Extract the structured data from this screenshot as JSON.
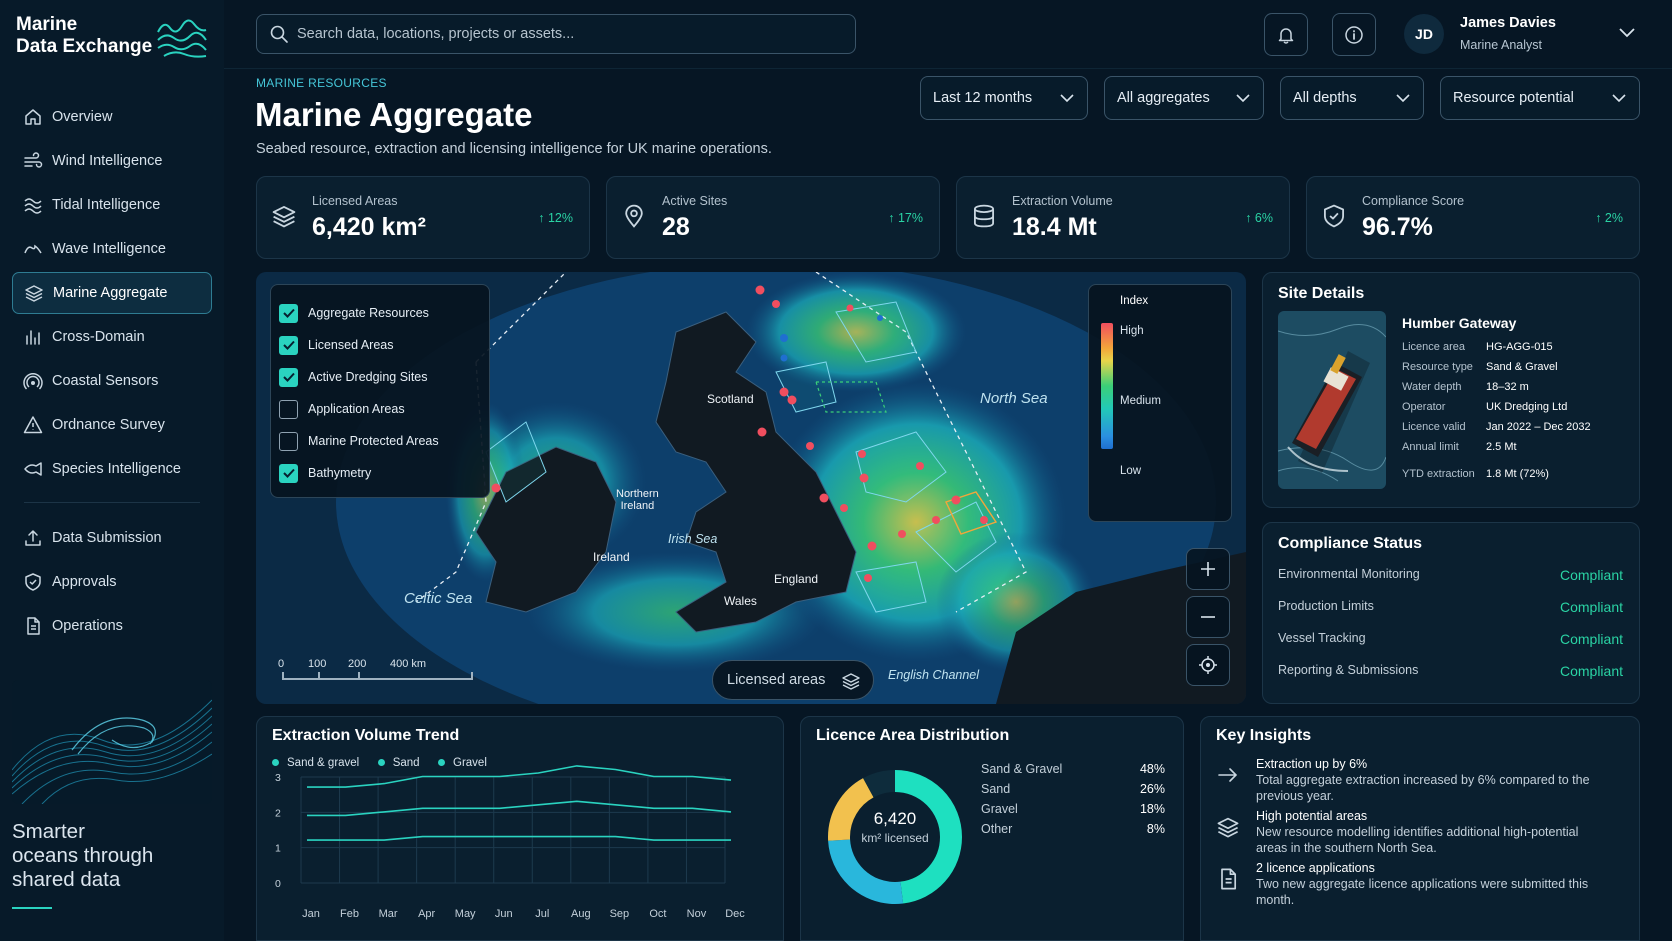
{
  "app": {
    "title_line1": "Marine",
    "title_line2": "Data Exchange",
    "tagline_line1": "Smarter",
    "tagline_line2": "oceans through",
    "tagline_line3": "shared data"
  },
  "sidebar": {
    "primary": [
      {
        "label": "Overview",
        "icon": "home-icon"
      },
      {
        "label": "Wind Intelligence",
        "icon": "wind-icon"
      },
      {
        "label": "Tidal Intelligence",
        "icon": "tide-icon"
      },
      {
        "label": "Wave Intelligence",
        "icon": "wave-icon"
      },
      {
        "label": "Marine Aggregate",
        "icon": "layers-icon",
        "active": true
      },
      {
        "label": "Cross-Domain",
        "icon": "bar-chart-icon"
      },
      {
        "label": "Coastal Sensors",
        "icon": "sensor-icon"
      },
      {
        "label": "Ordnance Survey",
        "icon": "warning-icon"
      },
      {
        "label": "Species Intelligence",
        "icon": "fish-icon"
      }
    ],
    "secondary": [
      {
        "label": "Data Submission",
        "icon": "upload-icon"
      },
      {
        "label": "Approvals",
        "icon": "shield-check-icon"
      },
      {
        "label": "Operations",
        "icon": "document-icon"
      }
    ]
  },
  "header": {
    "search_placeholder": "Search data, locations, projects or assets...",
    "user_initials": "JD",
    "user_name": "James Davies",
    "user_role": "Marine Analyst"
  },
  "page": {
    "eyebrow": "MARINE RESOURCES",
    "title": "Marine Aggregate",
    "subtitle": "Seabed resource, extraction and licensing intelligence for UK marine operations."
  },
  "filters": [
    {
      "label": "Last 12 months"
    },
    {
      "label": "All aggregates"
    },
    {
      "label": "All depths"
    },
    {
      "label": "Resource potential"
    }
  ],
  "kpis": [
    {
      "label": "Licensed Areas",
      "value": "6,420 km²",
      "delta": "12%",
      "icon": "layers-icon"
    },
    {
      "label": "Active Sites",
      "value": "28",
      "delta": "17%",
      "icon": "location-pin-icon"
    },
    {
      "label": "Extraction Volume",
      "value": "18.4 Mt",
      "delta": "6%",
      "icon": "database-icon"
    },
    {
      "label": "Compliance Score",
      "value": "96.7%",
      "delta": "2%",
      "icon": "shield-check-icon"
    }
  ],
  "map": {
    "layers": [
      {
        "label": "Aggregate Resources",
        "checked": true
      },
      {
        "label": "Licensed Areas",
        "checked": true
      },
      {
        "label": "Active Dredging Sites",
        "checked": true
      },
      {
        "label": "Application Areas",
        "checked": false
      },
      {
        "label": "Marine Protected Areas",
        "checked": false
      },
      {
        "label": "Bathymetry",
        "checked": true
      }
    ],
    "legend": {
      "title": "Index",
      "high": "High",
      "medium": "Medium",
      "low": "Low"
    },
    "labels": {
      "scotland": "Scotland",
      "northern_ireland_1": "Northern",
      "northern_ireland_2": "Ireland",
      "ireland": "Ireland",
      "england": "England",
      "wales": "Wales",
      "north_sea": "North Sea",
      "irish_sea": "Irish Sea",
      "celtic_sea": "Celtic Sea",
      "english_channel": "English Channel"
    },
    "scale": [
      "0",
      "100",
      "200",
      "400 km"
    ],
    "layer_pill": "Licensed areas"
  },
  "site_details": {
    "title": "Site Details",
    "name": "Humber Gateway",
    "rows": [
      {
        "k": "Licence area",
        "v": "HG-AGG-015"
      },
      {
        "k": "Resource type",
        "v": "Sand & Gravel"
      },
      {
        "k": "Water depth",
        "v": "18–32 m"
      },
      {
        "k": "Operator",
        "v": "UK Dredging Ltd"
      },
      {
        "k": "Licence valid",
        "v": "Jan 2022 – Dec 2032"
      },
      {
        "k": "Annual limit",
        "v": "2.5 Mt"
      },
      {
        "k": "YTD extraction",
        "v": "1.8 Mt (72%)"
      }
    ]
  },
  "compliance": {
    "title": "Compliance Status",
    "rows": [
      {
        "label": "Environmental Monitoring",
        "status": "Compliant"
      },
      {
        "label": "Production Limits",
        "status": "Compliant"
      },
      {
        "label": "Vessel Tracking",
        "status": "Compliant"
      },
      {
        "label": "Reporting & Submissions",
        "status": "Compliant"
      }
    ]
  },
  "trend": {
    "title": "Extraction Volume Trend",
    "chart_data": {
      "type": "line",
      "title": "Extraction Volume Trend",
      "categories": [
        "Jan",
        "Feb",
        "Mar",
        "Apr",
        "May",
        "Jun",
        "Jul",
        "Aug",
        "Sep",
        "Oct",
        "Nov",
        "Dec"
      ],
      "ylim": [
        0,
        3
      ],
      "yticks": [
        "3",
        "2",
        "1",
        "0"
      ],
      "grid": true,
      "legend": "top-left",
      "series": [
        {
          "name": "Sand & gravel",
          "values": [
            2.6,
            2.6,
            2.7,
            2.9,
            2.9,
            2.9,
            3.0,
            3.2,
            3.1,
            2.9,
            2.9,
            2.8
          ]
        },
        {
          "name": "Sand",
          "values": [
            1.8,
            1.8,
            1.9,
            2.0,
            2.0,
            2.0,
            2.1,
            2.2,
            2.1,
            2.0,
            2.0,
            1.9
          ]
        },
        {
          "name": "Gravel",
          "values": [
            1.1,
            1.1,
            1.1,
            1.2,
            1.2,
            1.2,
            1.2,
            1.2,
            1.2,
            1.1,
            1.1,
            1.1
          ]
        }
      ]
    }
  },
  "distribution": {
    "title": "Licence Area Distribution",
    "center_value": "6,420",
    "center_unit": "km² licensed",
    "chart_data": {
      "type": "pie",
      "title": "Licence Area Distribution",
      "categories": [
        "Sand & Gravel",
        "Sand",
        "Gravel",
        "Other"
      ],
      "values": [
        48,
        26,
        18,
        8
      ],
      "labels": [
        "48%",
        "26%",
        "18%",
        "8%"
      ]
    }
  },
  "insights": {
    "title": "Key Insights",
    "items": [
      {
        "icon": "arrow-right-icon",
        "head": "Extraction up by 6%",
        "body": "Total aggregate extraction increased by 6% compared to the previous year."
      },
      {
        "icon": "layers-icon",
        "head": "High potential areas",
        "body": "New resource modelling identifies additional high-potential areas in the southern North Sea."
      },
      {
        "icon": "document-icon",
        "head": "2 licence applications",
        "body": "Two new aggregate licence applications were submitted this month."
      }
    ]
  },
  "colors": {
    "accent": "#2ad3c0",
    "positive": "#2ad3a4",
    "background": "#061624",
    "panel": "#0a1f2f",
    "donut_sand_gravel": "#1ee0c0",
    "donut_sand": "#29b7dc",
    "donut_gravel": "#f2c14e",
    "donut_other": "#0e2c3c"
  }
}
